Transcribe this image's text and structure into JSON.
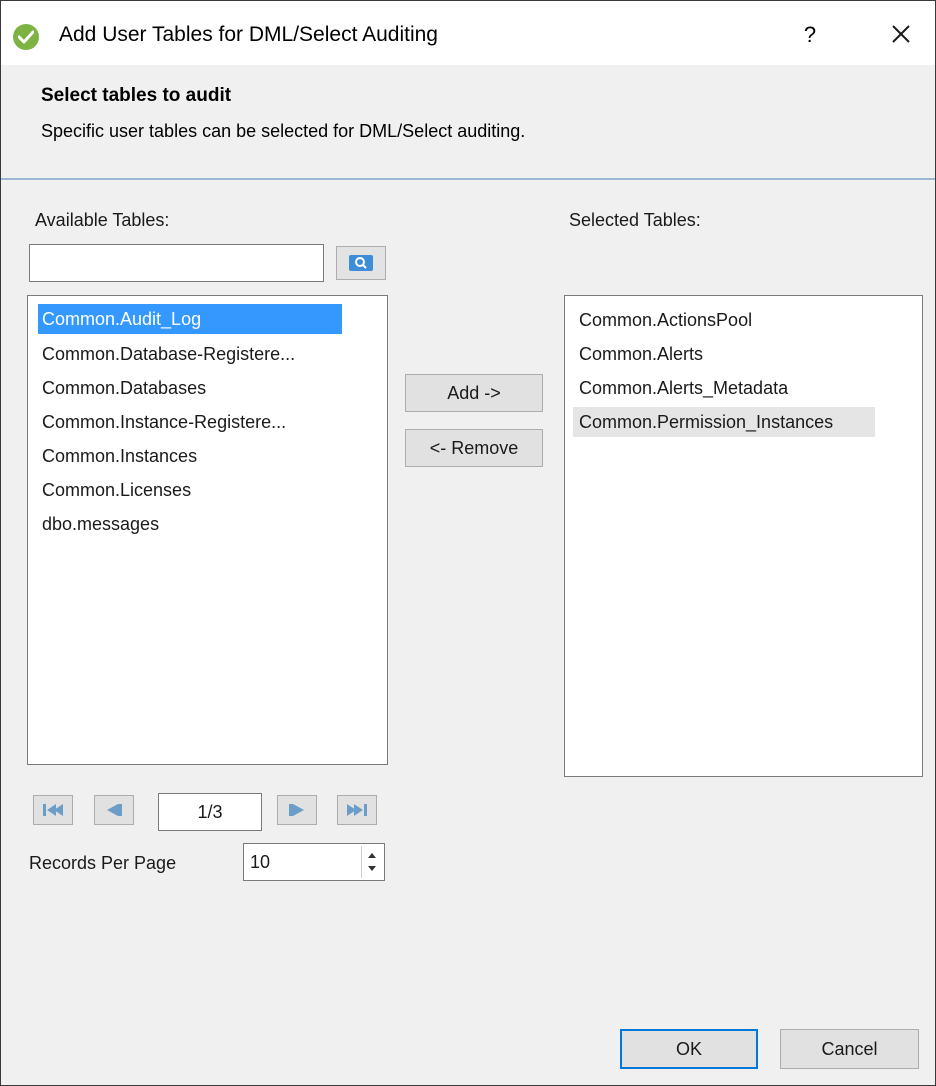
{
  "window": {
    "title": "Add User Tables for DML/Select Auditing",
    "help_label": "?"
  },
  "header": {
    "title": "Select tables to audit",
    "description": "Specific user tables can be selected for DML/Select auditing."
  },
  "available": {
    "label": "Available Tables:",
    "search_value": "",
    "items": [
      {
        "label": "Common.Audit_Log",
        "selected": true
      },
      {
        "label": "Common.Database-Registere..."
      },
      {
        "label": "Common.Databases"
      },
      {
        "label": "Common.Instance-Registere..."
      },
      {
        "label": "Common.Instances"
      },
      {
        "label": "Common.Licenses"
      },
      {
        "label": "dbo.messages"
      }
    ]
  },
  "selected": {
    "label": "Selected Tables:",
    "items": [
      {
        "label": "Common.ActionsPool"
      },
      {
        "label": "Common.Alerts"
      },
      {
        "label": "Common.Alerts_Metadata"
      },
      {
        "label": "Common.Permission_Instances",
        "hover": true
      }
    ]
  },
  "actions": {
    "add_label": "Add ->",
    "remove_label": "<- Remove"
  },
  "paging": {
    "page_display": "1/3",
    "records_label": "Records Per Page",
    "records_value": "10",
    "icons": [
      "first-page-icon",
      "previous-page-icon",
      "next-page-icon",
      "last-page-icon"
    ]
  },
  "footer": {
    "ok_label": "OK",
    "cancel_label": "Cancel"
  },
  "colors": {
    "selection": "#3399ff",
    "accent": "#0078d7",
    "app_icon": "#7cb342"
  }
}
